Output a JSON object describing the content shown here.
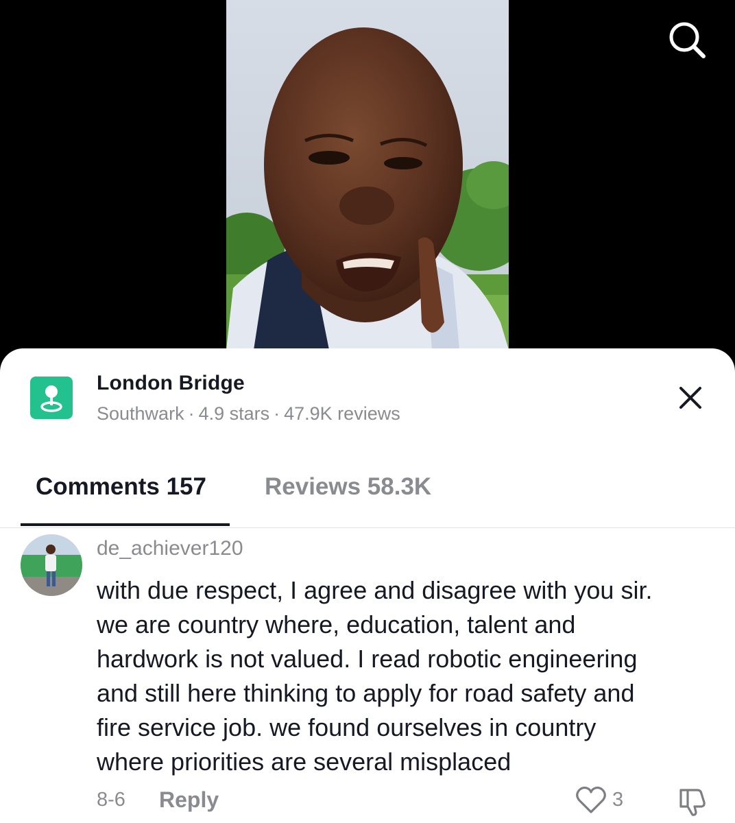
{
  "video": {
    "search_icon": "search-icon"
  },
  "place": {
    "icon": "location-pin-icon",
    "name": "London Bridge",
    "area": "Southwark",
    "separator": "·",
    "rating": "4.9 stars",
    "reviews": "47.9K reviews",
    "close_icon": "close-icon",
    "accent_color": "#23c18e"
  },
  "tabs": [
    {
      "label": "Comments 157",
      "active": true
    },
    {
      "label": "Reviews 58.3K",
      "active": false
    }
  ],
  "comment": {
    "username": "de_achiever120",
    "lines": [
      "with due respect, I agree and disagree with you sir.",
      "we are country where, education, talent and",
      "hardwork is not valued. I read robotic engineering",
      "and still here thinking to apply for road safety and",
      "fire service job. we found ourselves in country",
      "where priorities are several misplaced"
    ],
    "date": "8-6",
    "reply_label": "Reply",
    "like_count": "3",
    "like_icon": "heart-icon",
    "dislike_icon": "thumbs-down-icon"
  }
}
